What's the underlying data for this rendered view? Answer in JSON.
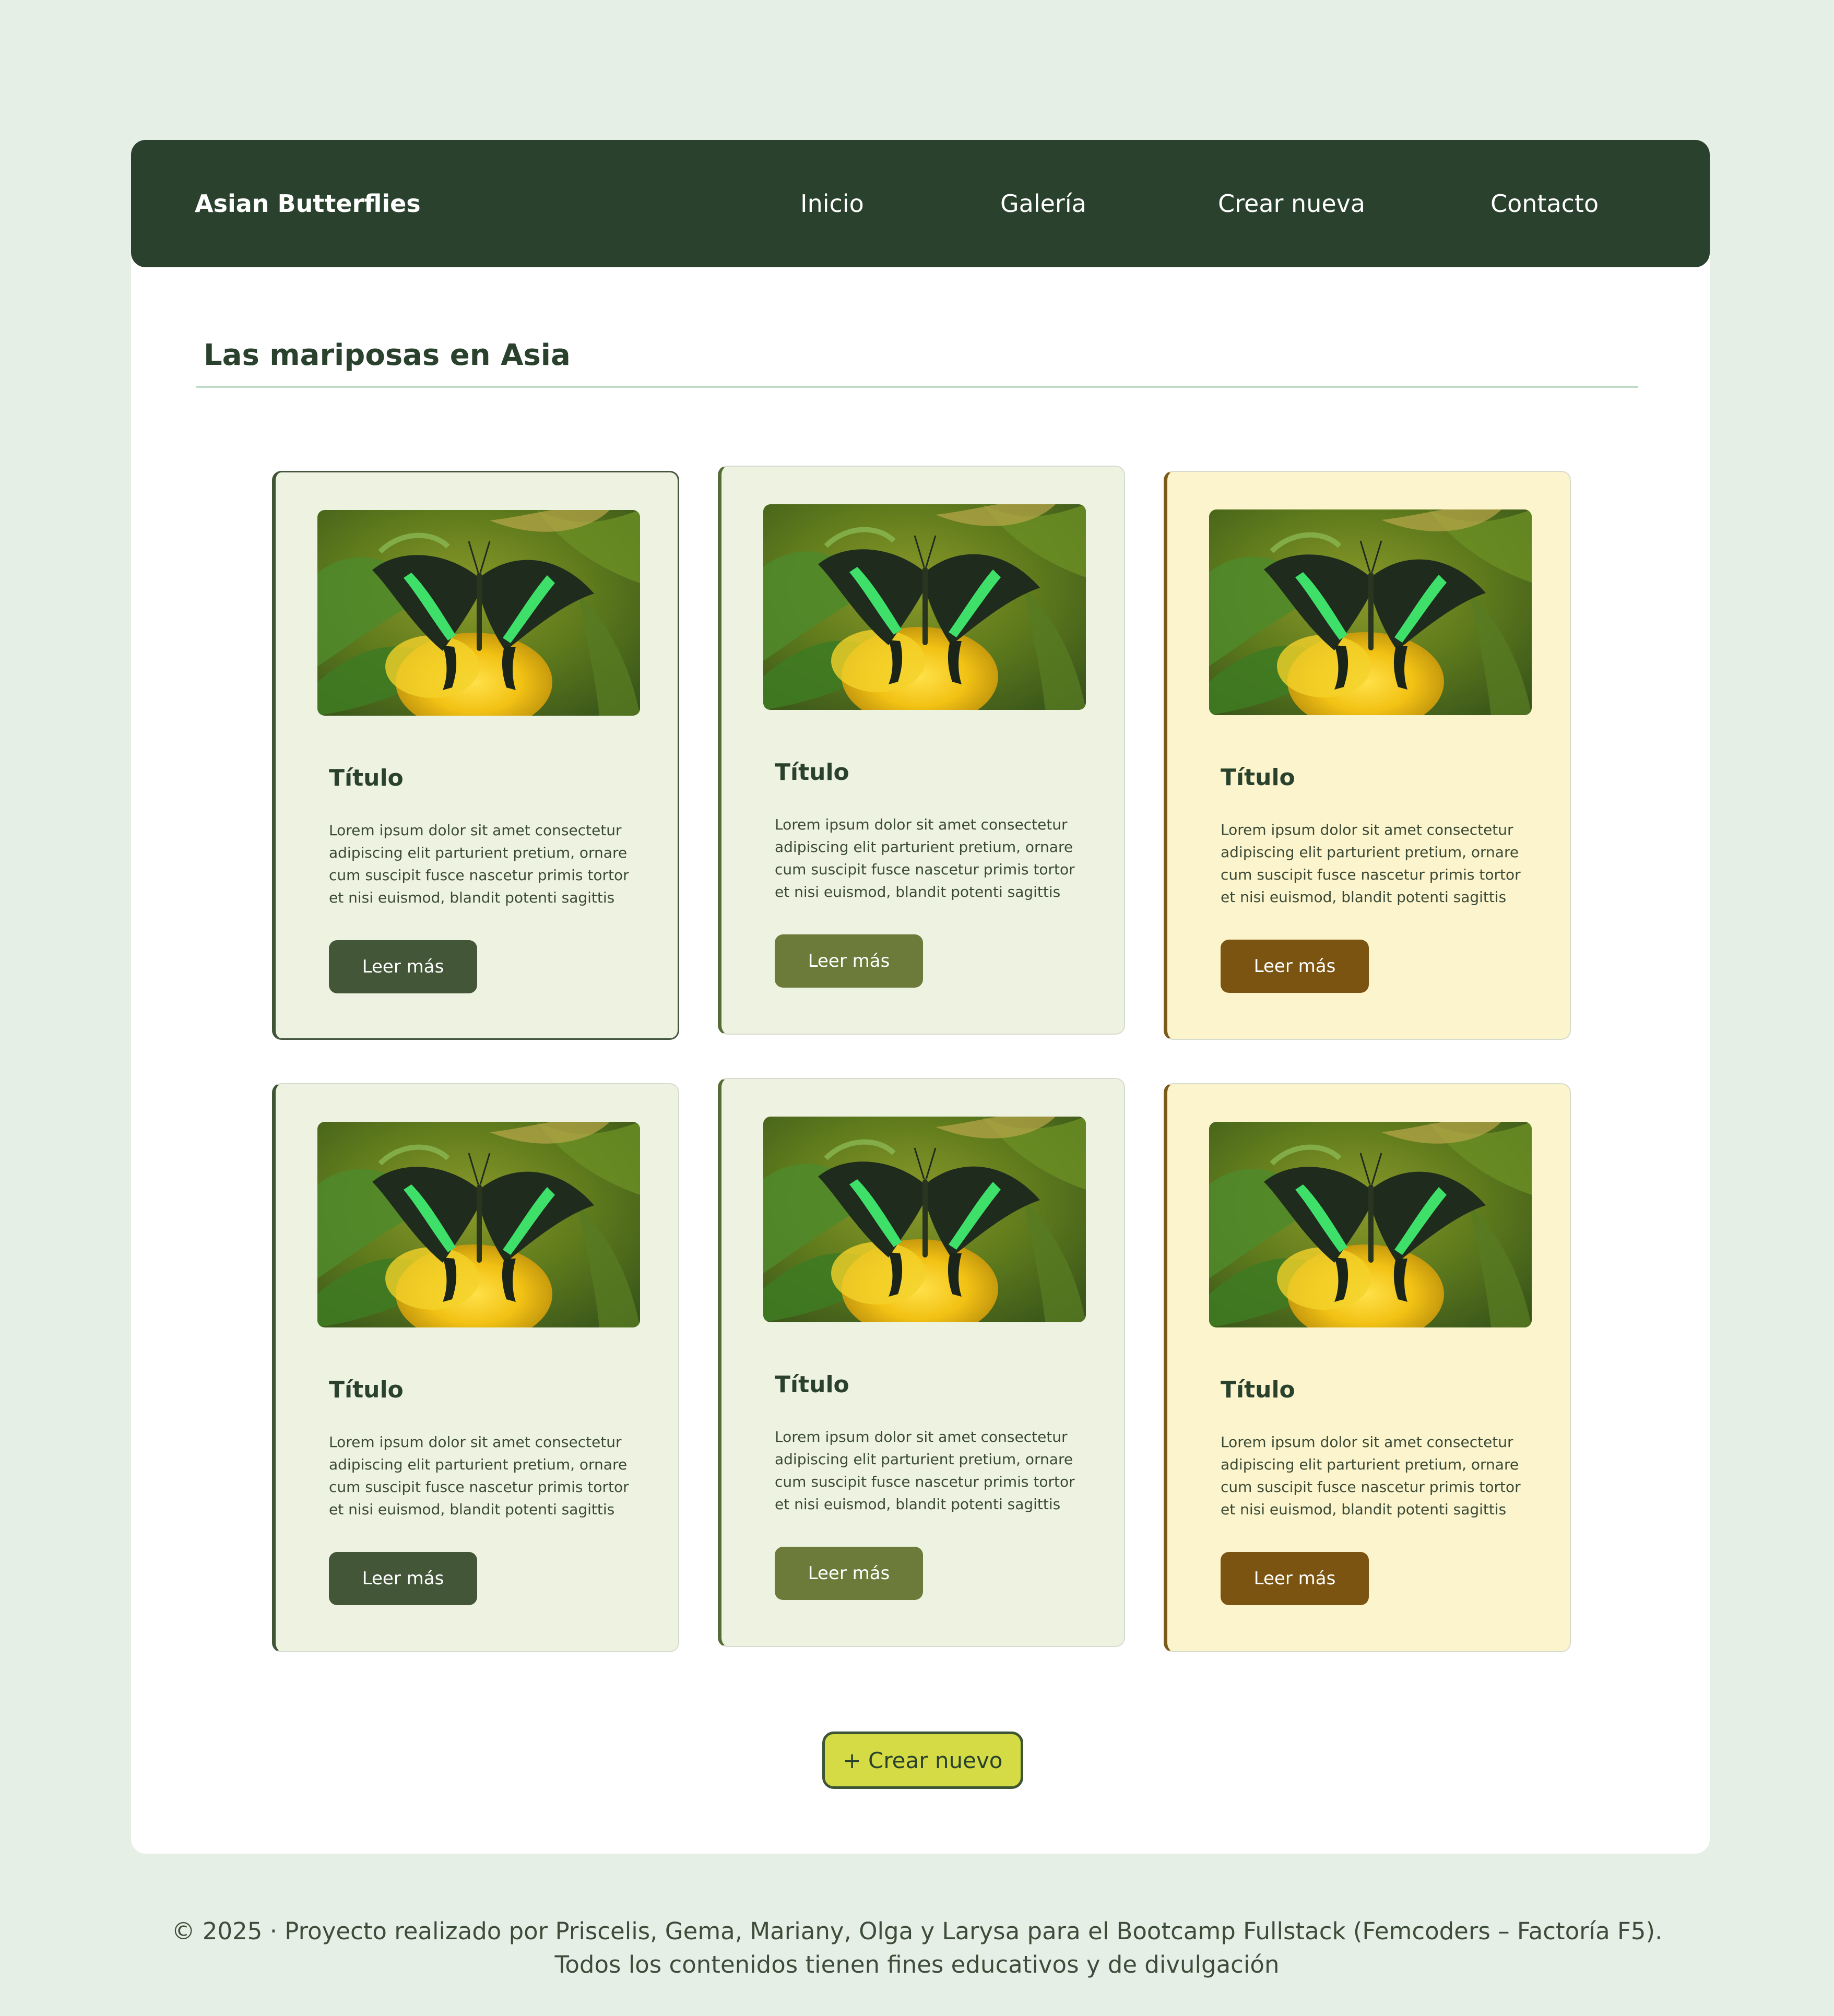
{
  "brand": "Asian Butterflies",
  "nav": [
    "Inicio",
    "Galería",
    "Crear nueva",
    "Contacto"
  ],
  "page_title": "Las mariposas en Asia",
  "cards": [
    {
      "title": "Título",
      "text": "Lorem ipsum dolor sit amet consectetur adipiscing elit parturient pretium, ornare cum suscipit fusce nascetur primis tortor et nisi euismod, blandit potenti sagittis",
      "button": "Leer más",
      "image": "emerald-swallowtail-butterfly-photo"
    },
    {
      "title": "Título",
      "text": "Lorem ipsum dolor sit amet consectetur adipiscing elit parturient pretium, ornare cum suscipit fusce nascetur primis tortor et nisi euismod, blandit potenti sagittis",
      "button": "Leer más",
      "image": "emerald-swallowtail-butterfly-photo"
    },
    {
      "title": "Título",
      "text": "Lorem ipsum dolor sit amet consectetur adipiscing elit parturient pretium, ornare cum suscipit fusce nascetur primis tortor et nisi euismod, blandit potenti sagittis",
      "button": "Leer más",
      "image": "emerald-swallowtail-butterfly-photo"
    },
    {
      "title": "Título",
      "text": "Lorem ipsum dolor sit amet consectetur adipiscing elit parturient pretium, ornare cum suscipit fusce nascetur primis tortor et nisi euismod, blandit potenti sagittis",
      "button": "Leer más",
      "image": "emerald-swallowtail-butterfly-photo"
    },
    {
      "title": "Título",
      "text": "Lorem ipsum dolor sit amet consectetur adipiscing elit parturient pretium, ornare cum suscipit fusce nascetur primis tortor et nisi euismod, blandit potenti sagittis",
      "button": "Leer más",
      "image": "emerald-swallowtail-butterfly-photo"
    },
    {
      "title": "Título",
      "text": "Lorem ipsum dolor sit amet consectetur adipiscing elit parturient pretium, ornare cum suscipit fusce nascetur primis tortor et nisi euismod, blandit potenti sagittis",
      "button": "Leer más",
      "image": "emerald-swallowtail-butterfly-photo"
    }
  ],
  "create_button": "+ Crear nuevo",
  "footer": {
    "line1": "© 2025 · Proyecto realizado por Priscelis, Gema, Mariany, Olga y Larysa para el Bootcamp Fullstack (Femcoders – Factoría F5).",
    "line2": "Todos los contenidos tienen fines educativos y de divulgación"
  },
  "colors": {
    "page_background": "#e6efe6",
    "navbar": "#29412d",
    "card_green": "#eef2e1",
    "card_yellow": "#fbf4cc",
    "button_dark_green": "#435738",
    "button_olive": "#6c7b3a",
    "button_brown": "#7b5411",
    "create_button": "#d4db44"
  }
}
